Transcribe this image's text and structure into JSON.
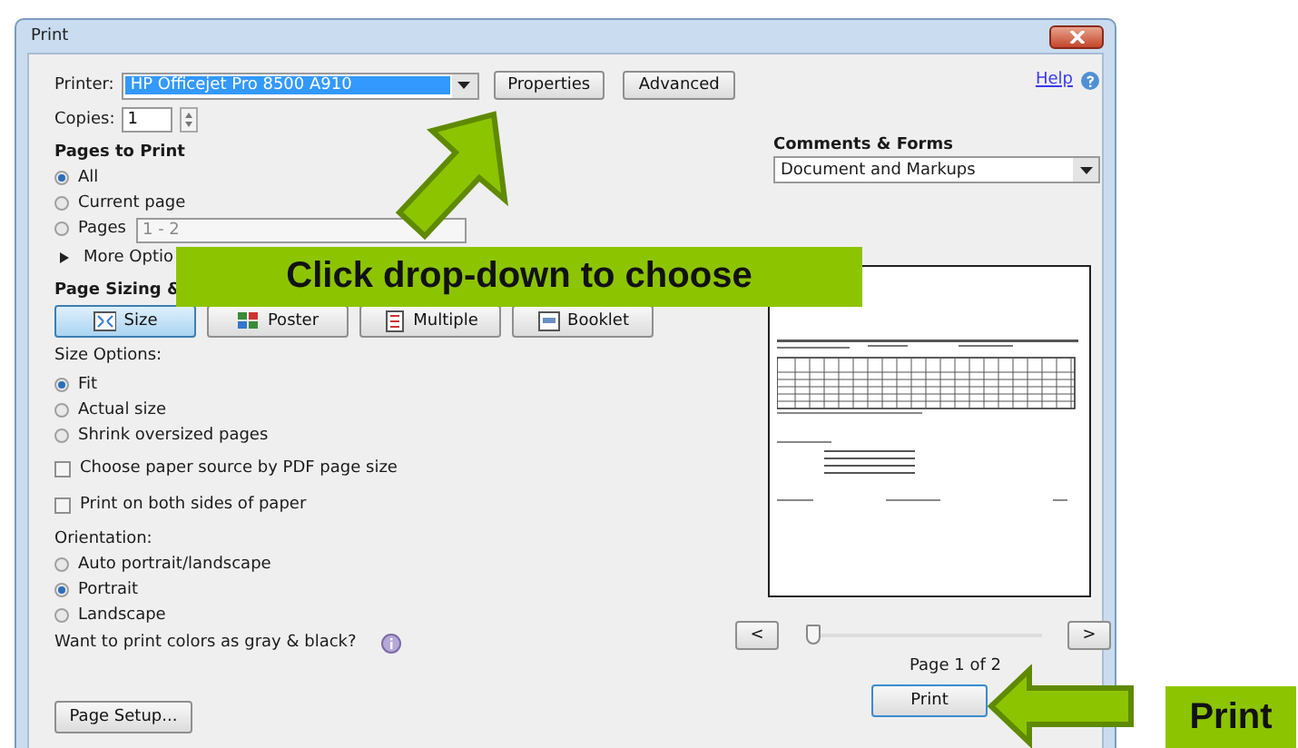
{
  "window": {
    "title": "Print"
  },
  "help": {
    "label": "Help"
  },
  "printer": {
    "label": "Printer:",
    "value": "HP Officejet Pro 8500 A910"
  },
  "top_buttons": [
    "Properties",
    "Advanced"
  ],
  "copies": {
    "label": "Copies:",
    "value": "1"
  },
  "pages_to_print": {
    "heading": "Pages to Print",
    "options": [
      {
        "label": "All",
        "selected": true
      },
      {
        "label": "Current page",
        "selected": false
      },
      {
        "label": "Pages",
        "selected": false
      }
    ],
    "pages_value": "1 - 2",
    "more_options": "More Optio"
  },
  "page_sizing": {
    "heading": "Page Sizing &",
    "modes": [
      {
        "label": "Size",
        "kind": "size",
        "selected": true
      },
      {
        "label": "Poster",
        "kind": "poster",
        "selected": false
      },
      {
        "label": "Multiple",
        "kind": "multiple",
        "selected": false
      },
      {
        "label": "Booklet",
        "kind": "booklet",
        "selected": false
      }
    ]
  },
  "size_options": {
    "heading": "Size Options:",
    "options": [
      {
        "label": "Fit",
        "selected": true
      },
      {
        "label": "Actual size",
        "selected": false
      },
      {
        "label": "Shrink oversized pages",
        "selected": false
      }
    ]
  },
  "checkboxes": [
    {
      "label": "Choose paper source by PDF page size",
      "checked": false
    },
    {
      "label": "Print on both sides of paper",
      "checked": false
    }
  ],
  "orientation": {
    "heading": "Orientation:",
    "options": [
      {
        "label": "Auto portrait/landscape",
        "selected": false
      },
      {
        "label": "Portrait",
        "selected": true
      },
      {
        "label": "Landscape",
        "selected": false
      }
    ]
  },
  "gray_question": "Want to print colors as gray & black?",
  "comments_forms": {
    "heading": "Comments & Forms",
    "value": "Document and Markups"
  },
  "preview": {
    "prev": "<",
    "next": ">",
    "slider": {
      "level": 0
    },
    "page_label": "Page 1 of 2"
  },
  "bottom_buttons": {
    "page_setup": "Page Setup...",
    "print": "Print"
  },
  "annotations": {
    "callout": "Click drop-down to choose",
    "print_label": "Print"
  }
}
